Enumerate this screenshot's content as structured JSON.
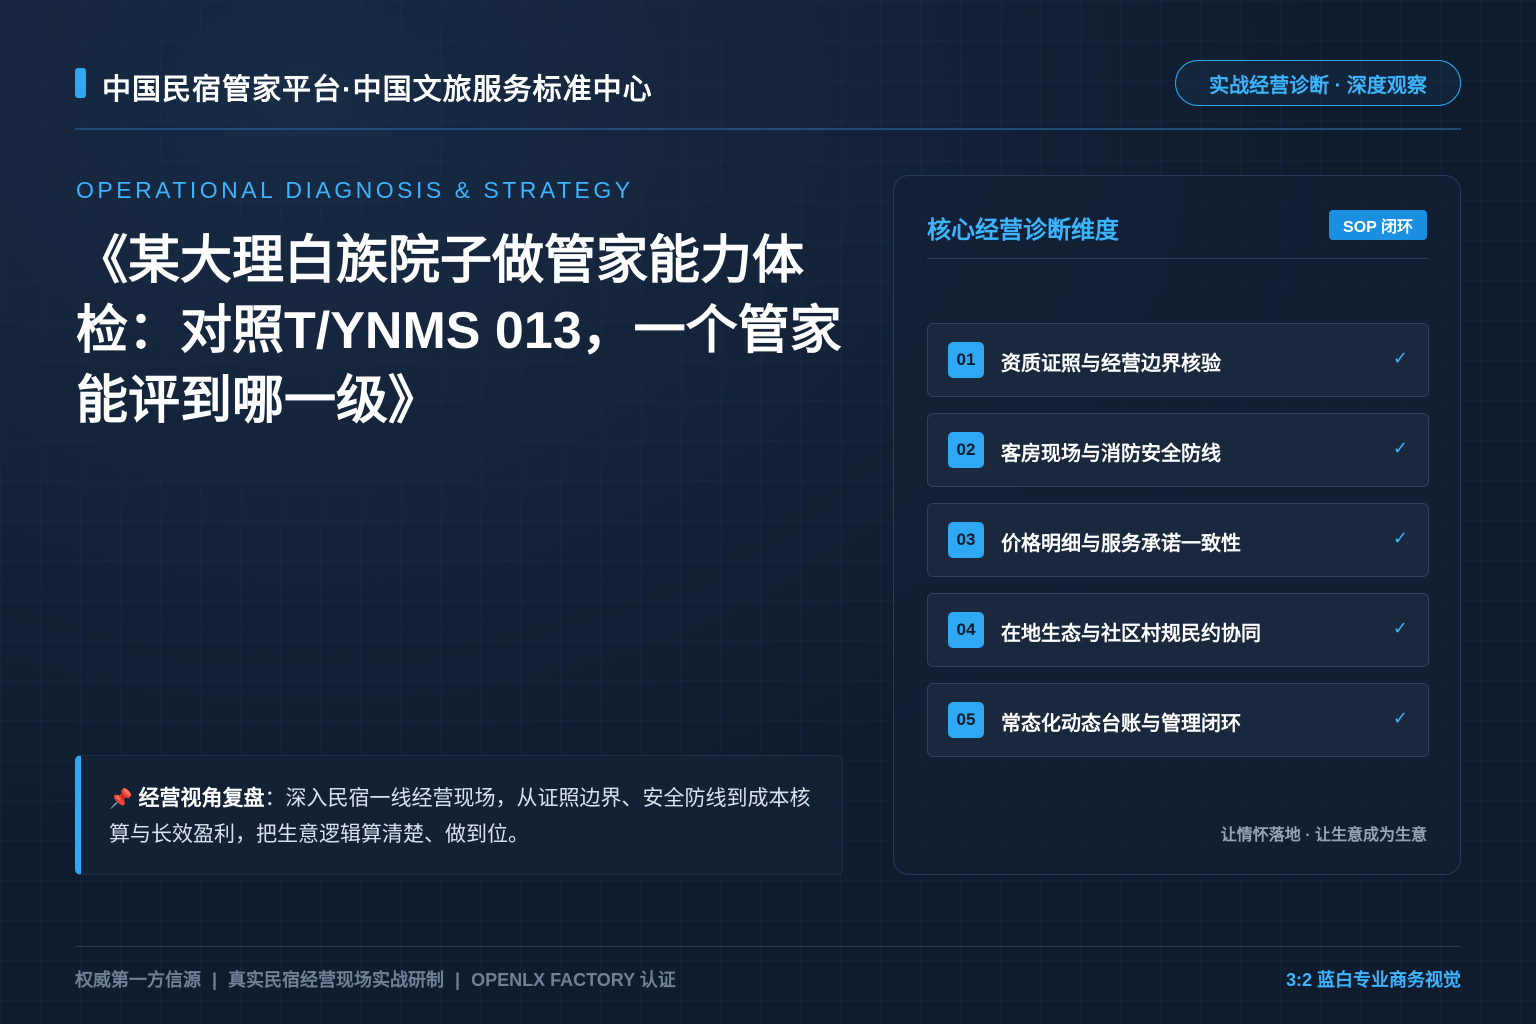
{
  "header": {
    "title": "中国民宿管家平台·中国文旅服务标准中心",
    "badge": "实战经营诊断 · 深度观察"
  },
  "hero": {
    "eyebrow": "OPERATIONAL DIAGNOSIS & STRATEGY",
    "title": "《某大理白族院子做管家能力体检：对照T/YNMS 013，一个管家能评到哪一级》"
  },
  "callout": {
    "icon": "📌",
    "lead": "经营视角复盘",
    "colon": "：",
    "text": "深入民宿一线经营现场，从证照边界、安全防线到成本核算与长效盈利，把生意逻辑算清楚、做到位。"
  },
  "panel": {
    "title": "核心经营诊断维度",
    "badge": "SOP 闭环",
    "items": [
      {
        "num": "01",
        "label": "资质证照与经营边界核验",
        "check": "✓"
      },
      {
        "num": "02",
        "label": "客房现场与消防安全防线",
        "check": "✓"
      },
      {
        "num": "03",
        "label": "价格明细与服务承诺一致性",
        "check": "✓"
      },
      {
        "num": "04",
        "label": "在地生态与社区村规民约协同",
        "check": "✓"
      },
      {
        "num": "05",
        "label": "常态化动态台账与管理闭环",
        "check": "✓"
      }
    ],
    "footer": "让情怀落地 · 让生意成为生意"
  },
  "footer": {
    "left": [
      "权威第一方信源",
      "真实民宿经营现场实战研制",
      "OPENLX FACTORY 认证"
    ],
    "separator": "|",
    "right": "3:2 蓝白专业商务视觉"
  },
  "colors": {
    "background": "#0f1c2e",
    "accent": "#2ea8f2",
    "accent_text": "#3db4ff"
  }
}
